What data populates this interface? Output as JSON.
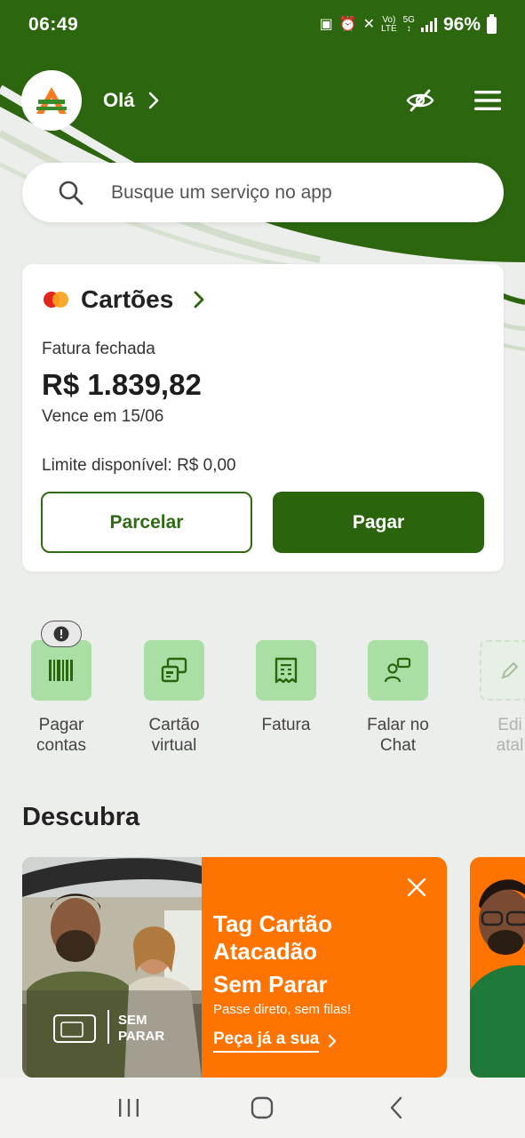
{
  "status_bar": {
    "time": "06:49",
    "battery": "96%"
  },
  "header": {
    "greeting": "Olá",
    "search_placeholder": "Busque um serviço no app"
  },
  "card": {
    "title": "Cartões",
    "status": "Fatura fechada",
    "amount": "R$ 1.839,82",
    "due": "Vence em 15/06",
    "limit": "Limite disponível: R$ 0,00",
    "btn_secondary": "Parcelar",
    "btn_primary": "Pagar"
  },
  "shortcuts": [
    {
      "line1": "Pagar",
      "line2": "contas",
      "icon": "barcode-icon"
    },
    {
      "line1": "Cartão",
      "line2": "virtual",
      "icon": "virtual-card-icon"
    },
    {
      "line1": "Fatura",
      "line2": "",
      "icon": "receipt-icon"
    },
    {
      "line1": "Falar no",
      "line2": "Chat",
      "icon": "chat-icon"
    },
    {
      "line1": "Edi",
      "line2": "atal",
      "icon": "pencil-icon"
    }
  ],
  "discover": {
    "title": "Descubra",
    "banner": {
      "title_l1": "Tag Cartão",
      "title_l2": "Atacadão",
      "title_l3": "Sem Parar",
      "subtitle": "Passe direto, sem filas!",
      "cta": "Peça já a sua",
      "brand_line1": "SEM",
      "brand_line2": "PARAR"
    }
  },
  "colors": {
    "brand_green": "#2a650e",
    "tile_green": "#a9dfa5",
    "banner_orange": "#ff7300"
  }
}
